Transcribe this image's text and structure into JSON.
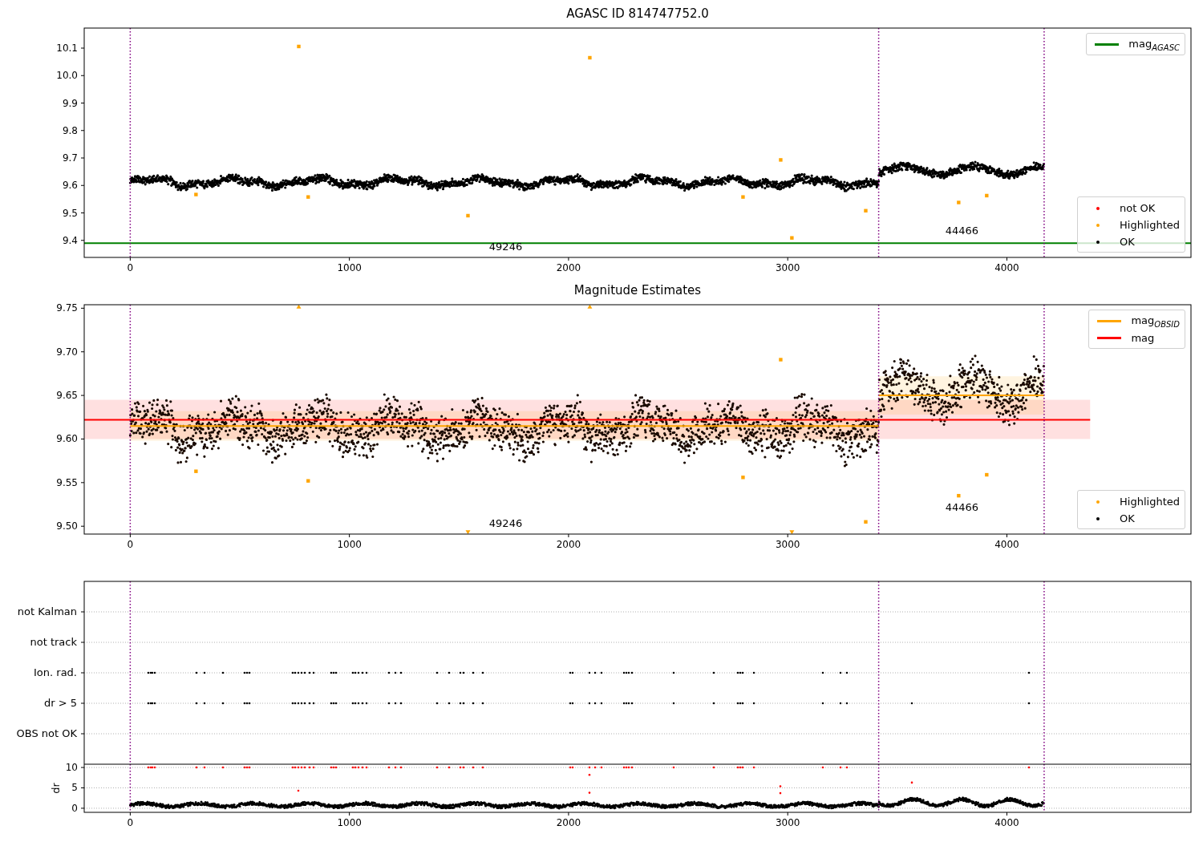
{
  "figure": {
    "panels": [
      {
        "kind": "magnitude",
        "chart_data": {
          "type": "scatter",
          "title": "AGASC ID 814747752.0",
          "xlim": [
            -210,
            4840
          ],
          "ylim": [
            9.338,
            10.173
          ],
          "xticks": [
            0,
            1000,
            2000,
            3000,
            4000
          ],
          "yticks": [
            {
              "value": 9.4,
              "label": "9.4"
            },
            {
              "value": 9.5,
              "label": "9.5"
            },
            {
              "value": 9.6,
              "label": "9.6"
            },
            {
              "value": 9.7,
              "label": "9.7"
            },
            {
              "value": 9.8,
              "label": "9.8"
            },
            {
              "value": 9.9,
              "label": "9.9"
            },
            {
              "value": 10.0,
              "label": "10.0"
            },
            {
              "value": 10.1,
              "label": "10.1"
            }
          ],
          "series": [
            {
              "type": "scatter",
              "color": "#ffa500",
              "x": [
                300,
                769,
                812,
                1541,
                2097,
                2796,
                2968,
                3019,
                3356,
                3780,
                3908
              ],
              "values": [
                9.567,
                10.106,
                9.558,
                9.49,
                10.065,
                9.558,
                9.693,
                9.409,
                9.508,
                9.538,
                9.563
              ]
            },
            {
              "type": "line",
              "color": "#008000",
              "x": [
                -210,
                4840
              ],
              "values": [
                9.39,
                9.39
              ]
            }
          ],
          "ref_lines": [
            {
              "axis": "x",
              "value": 0,
              "color": "#800080"
            },
            {
              "axis": "x",
              "value": 3415,
              "color": "#800080"
            },
            {
              "axis": "x",
              "value": 4170,
              "color": "#800080"
            }
          ],
          "annotations": [
            "49246",
            "44466"
          ]
        },
        "legends": [
          {
            "entries": [
              {
                "kind": "line",
                "color": "#008000",
                "label": "mag$_{AGASC}$"
              }
            ]
          },
          {
            "entries": [
              {
                "kind": "marker",
                "color": "#ff0000",
                "label": "not OK"
              },
              {
                "kind": "marker",
                "color": "#ffa500",
                "label": "Highlighted"
              },
              {
                "kind": "marker",
                "color": "#000000",
                "label": "OK"
              }
            ]
          }
        ]
      },
      {
        "kind": "magnitude",
        "chart_data": {
          "type": "scatter",
          "title": "Magnitude Estimates",
          "xlim": [
            -210,
            4840
          ],
          "ylim": [
            9.491,
            9.754
          ],
          "xticks": [
            0,
            1000,
            2000,
            3000,
            4000
          ],
          "yticks": [
            {
              "value": 9.5,
              "label": "9.50"
            },
            {
              "value": 9.55,
              "label": "9.55"
            },
            {
              "value": 9.6,
              "label": "9.60"
            },
            {
              "value": 9.65,
              "label": "9.65"
            },
            {
              "value": 9.7,
              "label": "9.70"
            },
            {
              "value": 9.75,
              "label": "9.75"
            }
          ],
          "series": [
            {
              "type": "scatter",
              "color": "#ffa500",
              "x": [
                300,
                769,
                812,
                1541,
                2097,
                2796,
                2968,
                3019,
                3356,
                3780,
                3908
              ],
              "values": [
                9.563,
                null,
                9.552,
                null,
                null,
                9.556,
                9.691,
                null,
                9.505,
                9.535,
                9.559
              ]
            },
            {
              "type": "scatter",
              "color": "#ffa500",
              "x": [
                769,
                2097,
                1541,
                3019
              ],
              "values": [
                9.752,
                9.752,
                9.493,
                9.493
              ]
            },
            {
              "type": "line",
              "color": "#ffa500",
              "x": [
                0,
                3415
              ],
              "values": [
                9.615,
                9.615
              ]
            },
            {
              "type": "line",
              "color": "#ffa500",
              "x": [
                3415,
                4170
              ],
              "values": [
                9.65,
                9.65
              ]
            },
            {
              "type": "line",
              "color": "#ff0000",
              "x": [
                -210,
                4380
              ],
              "values": [
                9.622,
                9.622
              ]
            }
          ],
          "bands": [
            {
              "axis": "y",
              "from": 9.6,
              "to": 9.645,
              "color": "#ff0000"
            },
            {
              "axis": "y",
              "from": 9.598,
              "to": 9.632,
              "color": "#ffa500"
            },
            {
              "axis": "y",
              "from": 9.628,
              "to": 9.672,
              "color": "#ffa500"
            }
          ],
          "ref_lines": [
            {
              "axis": "x",
              "value": 0,
              "color": "#800080"
            },
            {
              "axis": "x",
              "value": 3415,
              "color": "#800080"
            },
            {
              "axis": "x",
              "value": 4170,
              "color": "#800080"
            }
          ],
          "annotations": [
            "49246",
            "44466"
          ]
        },
        "legends": [
          {
            "entries": [
              {
                "kind": "line",
                "color": "#ffa500",
                "label": "mag$_{OBSID}$"
              },
              {
                "kind": "line",
                "color": "#ff0000",
                "label": "mag"
              }
            ]
          },
          {
            "entries": [
              {
                "kind": "marker",
                "color": "#ffa500",
                "label": "Highlighted"
              },
              {
                "kind": "marker",
                "color": "#000000",
                "label": "OK"
              }
            ]
          }
        ]
      },
      {
        "kind": "flags",
        "xticks": [
          "0",
          "1000",
          "2000",
          "3000",
          "4000"
        ],
        "flag_labels": [
          "not Kalman",
          "not track",
          "Ion. rad.",
          "dr > 5",
          "OBS not OK"
        ],
        "dr_axis": {
          "ylabel": "dr",
          "yticks": [
            "10",
            "5",
            "0"
          ]
        }
      }
    ]
  }
}
